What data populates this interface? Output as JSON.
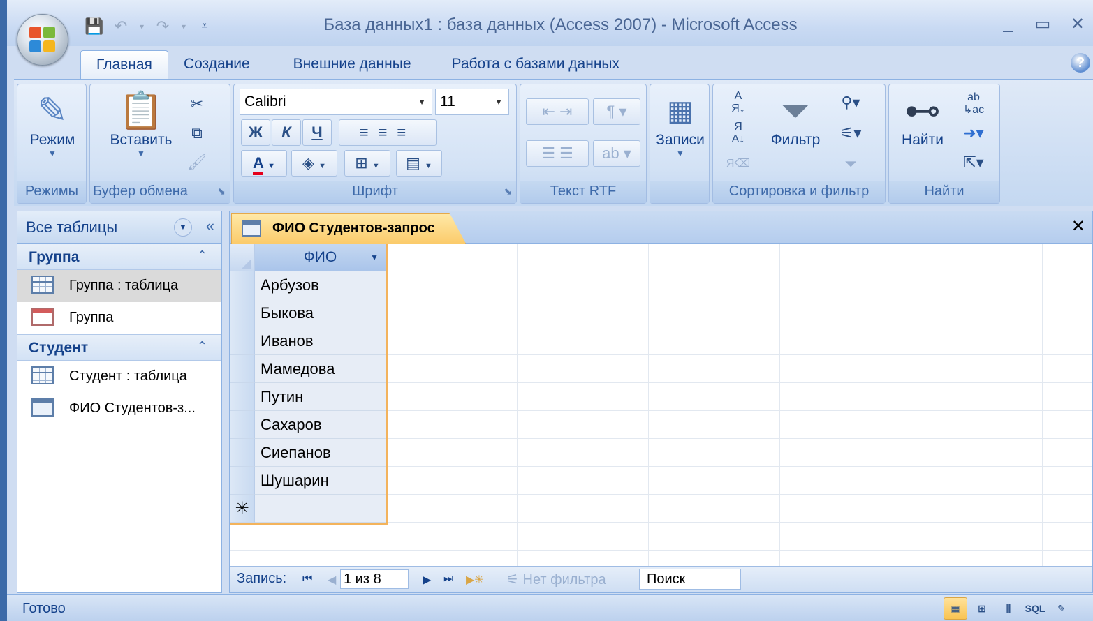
{
  "window": {
    "title": "База данных1 : база данных (Access 2007)  -  Microsoft Access",
    "controls": [
      "_",
      "▭",
      "✕"
    ]
  },
  "qat": [
    "save-icon",
    "undo-icon",
    "redo-icon",
    "customize-icon"
  ],
  "ribbon": {
    "tabs": [
      "Главная",
      "Создание",
      "Внешние данные",
      "Работа с базами данных"
    ],
    "active_tab": "Главная",
    "groups": {
      "modes": {
        "label": "Режимы",
        "mode_button": "Режим"
      },
      "clipboard": {
        "label": "Буфер обмена",
        "paste_button": "Вставить"
      },
      "font": {
        "label": "Шрифт",
        "font_name": "Calibri",
        "font_size": "11",
        "bold": "Ж",
        "italic": "К",
        "underline": "Ч",
        "font_color": "A"
      },
      "rtf": {
        "label": "Текст RTF"
      },
      "records": {
        "label": "",
        "records_button": "Записи"
      },
      "sort_filter": {
        "label": "Сортировка и фильтр",
        "filter_button": "Фильтр"
      },
      "find": {
        "label": "Найти",
        "find_button": "Найти"
      }
    }
  },
  "nav_pane": {
    "title": "Все таблицы",
    "sections": [
      {
        "name": "Группа",
        "items": [
          {
            "label": "Группа : таблица",
            "icon": "table-icon",
            "selected": true
          },
          {
            "label": "Группа",
            "icon": "form-icon",
            "selected": false
          }
        ]
      },
      {
        "name": "Студент",
        "items": [
          {
            "label": "Студент : таблица",
            "icon": "table-icon",
            "selected": false
          },
          {
            "label": "ФИО Студентов-з...",
            "icon": "query-icon",
            "selected": false
          }
        ]
      }
    ]
  },
  "document": {
    "tab_title": "ФИО Студентов-запрос",
    "column_header": "ФИО",
    "rows": [
      "Арбузов",
      "Быкова",
      "Иванов",
      "Мамедова",
      "Путин",
      "Сахаров",
      "Сиепанов",
      "Шушарин"
    ],
    "new_row_marker": "✳"
  },
  "record_nav": {
    "label": "Запись:",
    "position": "1 из 8",
    "filter_status": "Нет фильтра",
    "search_placeholder": "Поиск"
  },
  "status": {
    "text": "Готово",
    "views": [
      "datasheet-view-icon",
      "pivottable-view-icon",
      "pivotchart-view-icon",
      "SQL",
      "design-view-icon"
    ]
  },
  "colors": {
    "accent": "#f3b35c",
    "ribbon": "#c4d8f1",
    "text": "#15428b"
  }
}
